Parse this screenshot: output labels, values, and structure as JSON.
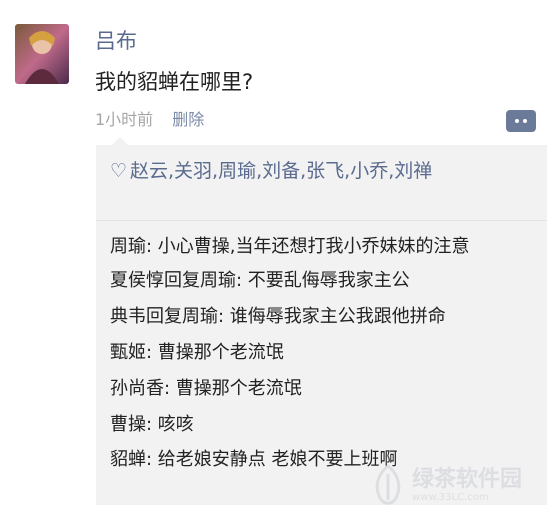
{
  "post": {
    "author": "吕布",
    "text": "我的貂蝉在哪里?",
    "time": "1小时前",
    "delete_label": "删除"
  },
  "likes": {
    "icon": "heart-icon",
    "names": "赵云,关羽,周瑜,刘备,张飞,小乔,刘禅"
  },
  "comments": [
    {
      "text": "周瑜: 小心曹操,当年还想打我小乔妹妹的注意"
    },
    {
      "text": "夏侯惇回复周瑜: 不要乱侮辱我家主公"
    },
    {
      "text": "典韦回复周瑜: 谁侮辱我家主公我跟他拼命"
    },
    {
      "text": "甄姬: 曹操那个老流氓"
    },
    {
      "text": "孙尚香: 曹操那个老流氓"
    },
    {
      "text": "曹操: 咳咳"
    },
    {
      "text": "貂蝉: 给老娘安静点 老娘不要上班啊"
    }
  ],
  "watermark": {
    "main": "绿茶软件园",
    "sub": "www.33LC.com"
  }
}
